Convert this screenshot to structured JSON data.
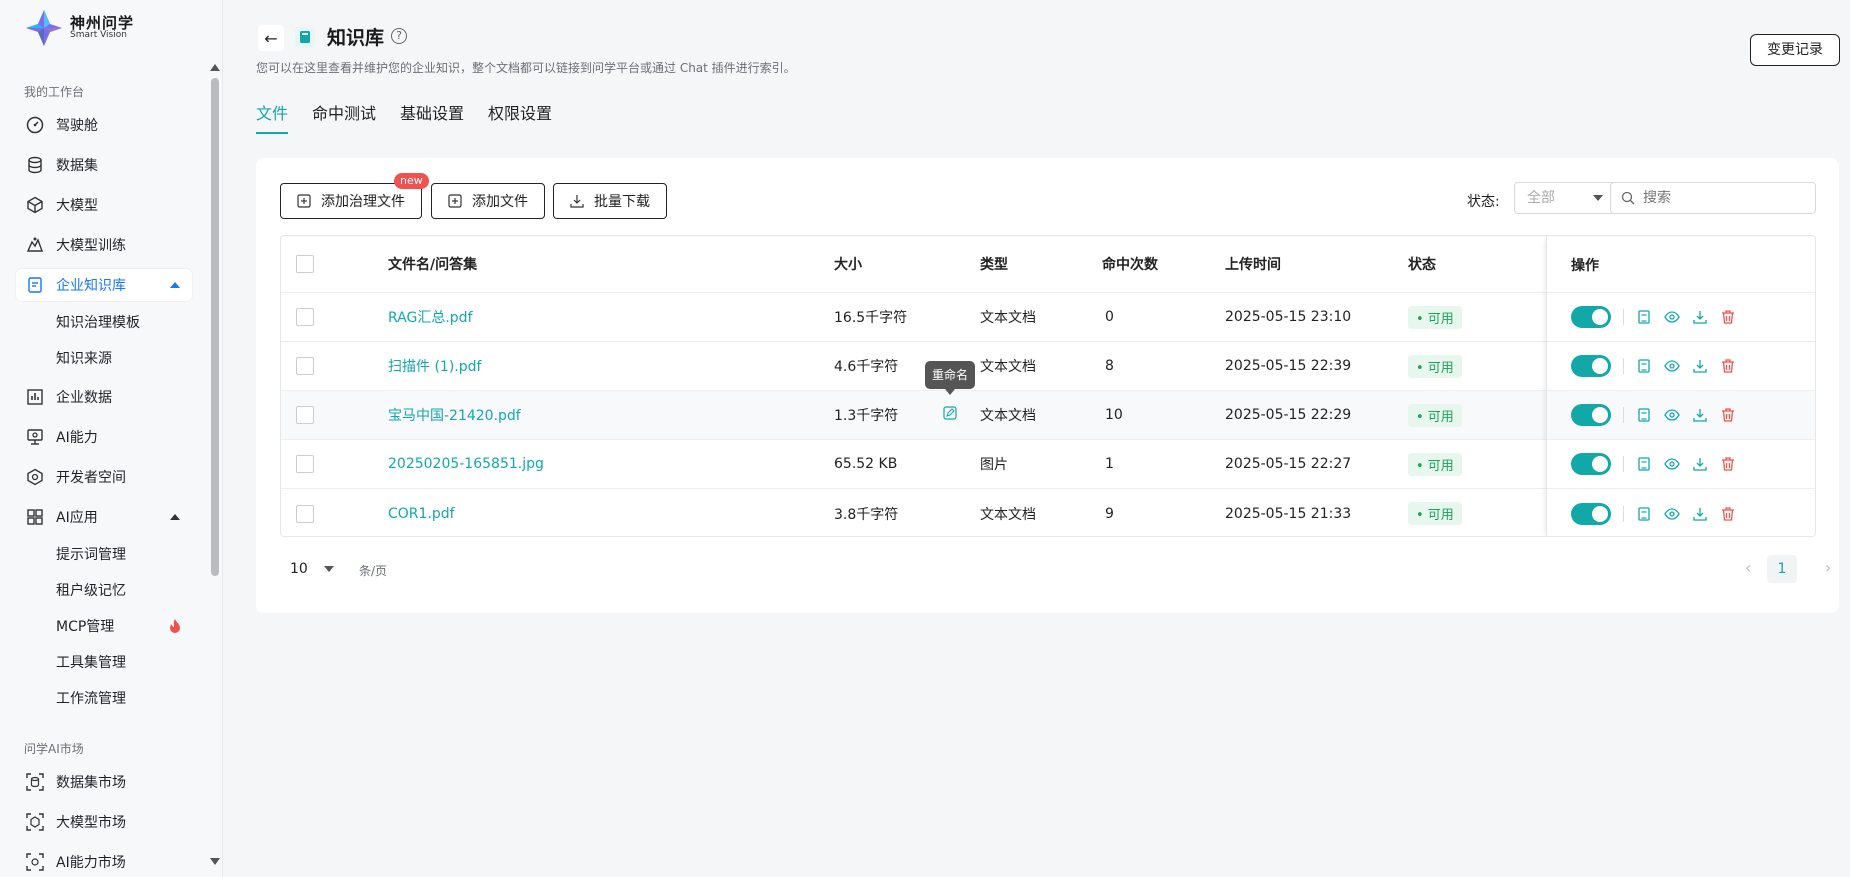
{
  "brand": {
    "name": "神州问学",
    "tagline": "Smart Vision"
  },
  "sidebar": {
    "section1_label": "我的工作台",
    "items": [
      {
        "label": "驾驶舱",
        "icon": "dashboard-icon"
      },
      {
        "label": "数据集",
        "icon": "database-icon"
      },
      {
        "label": "大模型",
        "icon": "cube-icon"
      },
      {
        "label": "大模型训练",
        "icon": "training-icon"
      },
      {
        "label": "企业知识库",
        "icon": "knowledge-icon",
        "active": true
      },
      {
        "label": "企业数据",
        "icon": "chart-icon"
      },
      {
        "label": "AI能力",
        "icon": "monitor-icon"
      },
      {
        "label": "开发者空间",
        "icon": "dev-icon"
      },
      {
        "label": "AI应用",
        "icon": "apps-icon"
      }
    ],
    "kb_sub": [
      "知识治理模板",
      "知识来源"
    ],
    "app_sub": [
      "提示词管理",
      "租户级记忆",
      "MCP管理",
      "工具集管理",
      "工作流管理"
    ],
    "section2_label": "问学AI市场",
    "market": [
      {
        "label": "数据集市场",
        "icon": "dataset-market-icon"
      },
      {
        "label": "大模型市场",
        "icon": "model-market-icon"
      },
      {
        "label": "AI能力市场",
        "icon": "ai-market-icon"
      }
    ]
  },
  "header": {
    "title": "知识库",
    "description": "您可以在这里查看并维护您的企业知识，整个文档都可以链接到问学平台或通过 Chat 插件进行索引。",
    "change_log": "变更记录"
  },
  "tabs": [
    "文件",
    "命中测试",
    "基础设置",
    "权限设置"
  ],
  "toolbar": {
    "add_governed": "添加治理文件",
    "new_badge": "new",
    "add_file": "添加文件",
    "batch_download": "批量下载",
    "status_label": "状态:",
    "status_value": "全部",
    "search_placeholder": "搜索"
  },
  "table": {
    "headers": [
      "文件名/问答集",
      "大小",
      "类型",
      "命中次数",
      "上传时间",
      "状态",
      "操作"
    ],
    "rows": [
      {
        "name": "RAG汇总.pdf",
        "size": "16.5千字符",
        "type": "文本文档",
        "hits": "0",
        "time": "2025-05-15 23:10",
        "status": "• 可用"
      },
      {
        "name": "扫描件 (1).pdf",
        "size": "4.6千字符",
        "type": "文本文档",
        "hits": "8",
        "time": "2025-05-15 22:39",
        "status": "• 可用"
      },
      {
        "name": "宝马中国-21420.pdf",
        "size": "1.3千字符",
        "type": "文本文档",
        "hits": "10",
        "time": "2025-05-15 22:29",
        "status": "• 可用"
      },
      {
        "name": "20250205-165851.jpg",
        "size": "65.52 KB",
        "type": "图片",
        "hits": "1",
        "time": "2025-05-15 22:27",
        "status": "• 可用"
      },
      {
        "name": "COR1.pdf",
        "size": "3.8千字符",
        "type": "文本文档",
        "hits": "9",
        "time": "2025-05-15 21:33",
        "status": "• 可用"
      }
    ]
  },
  "tooltip": "重命名",
  "pager": {
    "page_size": "10",
    "unit": "条/页",
    "current": "1"
  },
  "colors": {
    "accent": "#13a8a8",
    "active_nav": "#1677ff",
    "danger": "#f0524f",
    "status_green": "#1aa35a"
  }
}
